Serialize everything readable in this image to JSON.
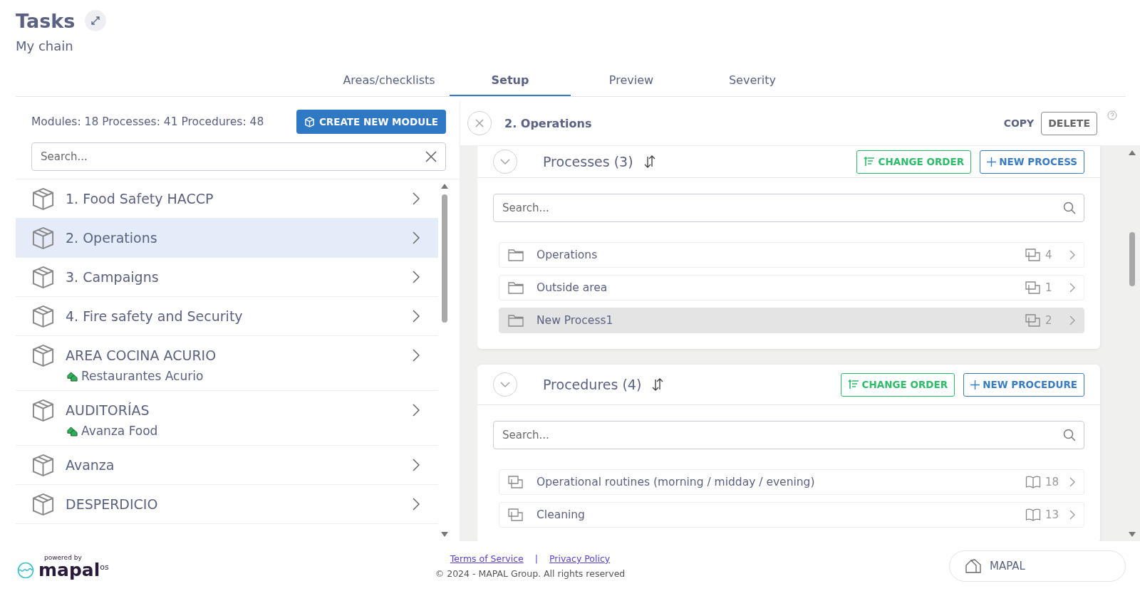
{
  "header": {
    "title": "Tasks",
    "subtitle": "My chain"
  },
  "tabs": [
    {
      "label": "Areas/checklists",
      "selected": false
    },
    {
      "label": "Setup",
      "selected": true
    },
    {
      "label": "Preview",
      "selected": false
    },
    {
      "label": "Severity",
      "selected": false
    }
  ],
  "modules_panel": {
    "stats": "Modules: 18 Processes: 41 Procedures: 48",
    "create_button": "CREATE NEW MODULE",
    "search": {
      "placeholder": "Search..."
    },
    "items": [
      {
        "name": "1. Food Safety HACCP",
        "selected": false
      },
      {
        "name": "2. Operations",
        "selected": true
      },
      {
        "name": "3. Campaigns",
        "selected": false
      },
      {
        "name": "4. Fire safety and Security",
        "selected": false
      },
      {
        "name": "AREA COCINA ACURIO",
        "selected": false,
        "location": "Restaurantes Acurio"
      },
      {
        "name": "AUDITORÍAS",
        "selected": false,
        "location": "Avanza Food"
      },
      {
        "name": "Avanza",
        "selected": false
      },
      {
        "name": "DESPERDICIO",
        "selected": false
      }
    ]
  },
  "detail": {
    "title": "2. Operations",
    "copy_button": "COPY",
    "delete_button": "DELETE",
    "sections": [
      {
        "kind": "processes",
        "title": "Processes (3)",
        "change_order_button": "CHANGE ORDER",
        "new_button": "NEW PROCESS",
        "search": {
          "placeholder": "Search..."
        },
        "rows": [
          {
            "name": "Operations",
            "count": "4",
            "selected": false
          },
          {
            "name": "Outside area",
            "count": "1",
            "selected": false
          },
          {
            "name": "New Process1",
            "count": "2",
            "selected": true
          }
        ]
      },
      {
        "kind": "procedures",
        "title": "Procedures (4)",
        "change_order_button": "CHANGE ORDER",
        "new_button": "NEW PROCEDURE",
        "search": {
          "placeholder": "Search..."
        },
        "rows": [
          {
            "name": "Operational routines (morning / midday / evening)",
            "count": "18",
            "selected": false
          },
          {
            "name": "Cleaning",
            "count": "13",
            "selected": false
          }
        ]
      }
    ]
  },
  "footer": {
    "powered_by": "powered by",
    "logo": "mapal",
    "logo_suffix": "os",
    "links": [
      "Terms of Service",
      "Privacy Policy"
    ],
    "separator": "|",
    "copyright": "© 2024 - MAPAL Group. All rights reserved",
    "org_button": "MAPAL"
  }
}
